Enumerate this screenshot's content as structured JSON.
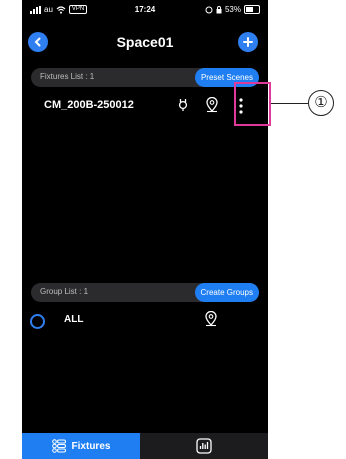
{
  "status_bar": {
    "carrier": "au",
    "vpn": "VPN",
    "time": "17:24",
    "battery": "53%"
  },
  "header": {
    "title": "Space01",
    "back_icon": "chevron-left-icon",
    "add_icon": "plus-icon"
  },
  "fixtures": {
    "label": "Fixtures List : 1",
    "preset_button": "Preset Scenes",
    "items": [
      {
        "name": "CM_200B-250012",
        "icons": [
          "plug-icon",
          "location-pin-icon",
          "more-vertical-icon"
        ]
      }
    ]
  },
  "groups": {
    "label": "Group List : 1",
    "create_button": "Create Groups",
    "items": [
      {
        "name": "ALL",
        "icon": "location-pin-icon"
      }
    ]
  },
  "tabbar": {
    "tabs": [
      {
        "label": "Fixtures",
        "icon": "fixtures-icon",
        "active": true
      },
      {
        "label": "",
        "icon": "equalizer-icon",
        "active": false
      }
    ]
  },
  "annotation": {
    "callout": "①",
    "color": "#e0399a"
  },
  "colors": {
    "accent": "#1f7ff2",
    "background": "#000000",
    "section_bar": "#2b2b2d"
  }
}
